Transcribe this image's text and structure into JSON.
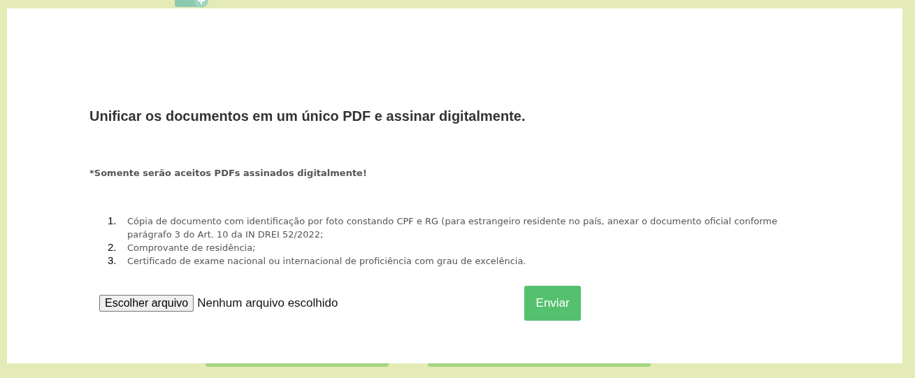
{
  "dialog": {
    "title": "Unificar os documentos em um único PDF e assinar digitalmente.",
    "note": "*Somente serão aceitos PDFs assinados digitalmente!",
    "requirements": [
      {
        "number": "1.",
        "text": "Cópia de documento com identificação por foto constando CPF e RG (para estrangeiro residente no país, anexar o documento oficial conforme parágrafo 3 do Art. 10 da IN DREI 52/2022;"
      },
      {
        "number": "2.",
        "text": "Comprovante de residência;"
      },
      {
        "number": "3.",
        "text": "Certificado de exame nacional ou internacional de proficiência com grau de excelência."
      }
    ],
    "file_input": {
      "button": "Escolher arquivo",
      "status": "Nenhum arquivo escolhido"
    },
    "submit": "Enviar"
  }
}
